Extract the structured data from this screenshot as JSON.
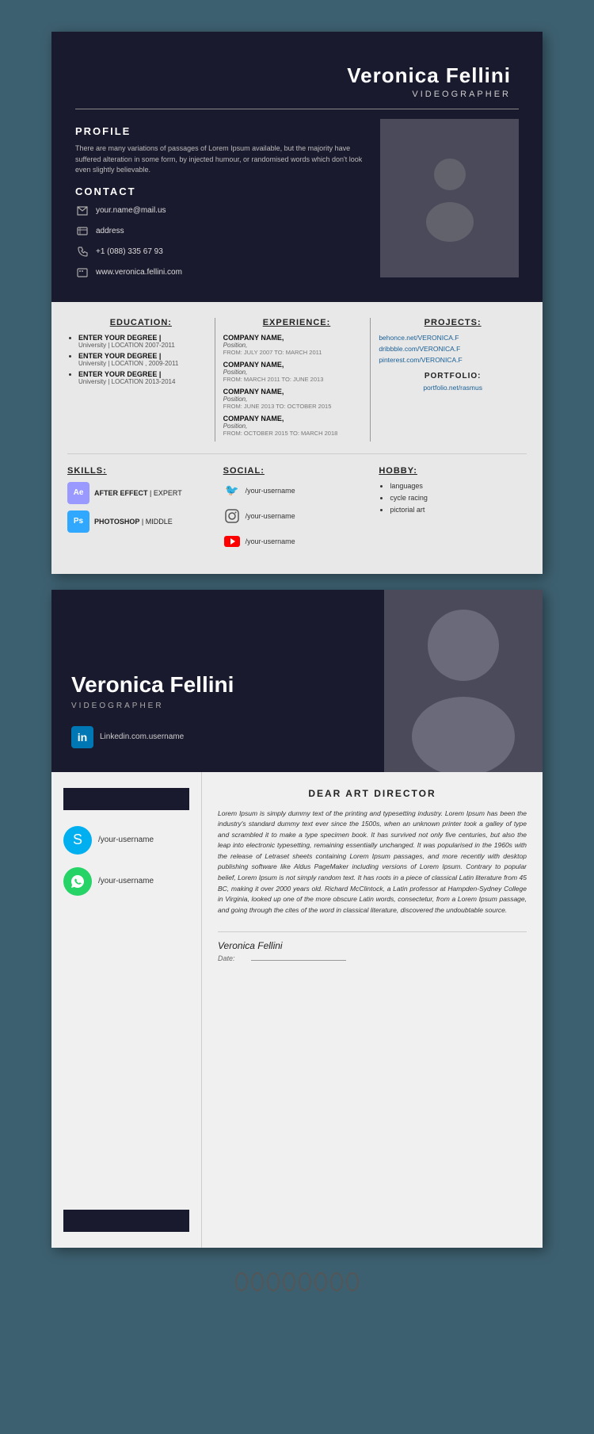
{
  "page": {
    "background_color": "#3d6070"
  },
  "resume1": {
    "header": {
      "name": "Veronica Fellini",
      "title": "VIDEOGRAPHER",
      "profile_label": "PROFILE",
      "profile_text": "There are many variations of passages of Lorem Ipsum available, but the majority have suffered alteration in some form, by injected humour, or randomised words which don't look even slightly believable.",
      "contact_label": "CONTACT",
      "email": "your.name@mail.us",
      "address": "address",
      "phone": "+1 (088) 335 67 93",
      "website": "www.veronica.fellini.com"
    },
    "education": {
      "title": "EDUCATION:",
      "items": [
        {
          "degree": "ENTER YOUR DEGREE |",
          "sub": "University | LOCATION 2007-2011"
        },
        {
          "degree": "ENTER YOUR DEGREE |",
          "sub": "University | LOCATION , 2009-2011"
        },
        {
          "degree": "ENTER YOUR DEGREE |",
          "sub": "University | LOCATION 2013-2014"
        }
      ]
    },
    "experience": {
      "title": "EXPERIENCE:",
      "items": [
        {
          "company": "COMPANY NAME,",
          "position": "Position,",
          "dates": "FROM: JULY 2007 TO: MARCH 2011"
        },
        {
          "company": "COMPANY NAME,",
          "position": "Position,",
          "dates": "FROM: MARCH 2011 TO: JUNE 2013"
        },
        {
          "company": "COMPANY NAME,",
          "position": "Position,",
          "dates": "FROM: JUNE 2013 TO: OCTOBER 2015"
        },
        {
          "company": "COMPANY NAME,",
          "position": "Position,",
          "dates": "FROM: OCTOBER 2015 TO: MARCH 2018"
        }
      ]
    },
    "projects": {
      "title": "PROJECTS:",
      "links": [
        "behonce.net/VERONICA.F",
        "dribbble.com/VERONICA.F",
        "pinterest.com/VERONICA.F"
      ],
      "portfolio_label": "PORTFOLIO:",
      "portfolio_link": "portfolio.net/rasmus"
    },
    "skills": {
      "title": "SKILLS:",
      "items": [
        {
          "name": "AFTER EFFECT",
          "level": "EXPERT",
          "badge": "Ae"
        },
        {
          "name": "PHOTOSHOP",
          "level": "MIDDLE",
          "badge": "Ps"
        }
      ]
    },
    "social": {
      "title": "SOCIAL:",
      "items": [
        {
          "platform": "twitter",
          "handle": "/your-username"
        },
        {
          "platform": "instagram",
          "handle": "/your-username"
        },
        {
          "platform": "youtube",
          "handle": "/your-username"
        }
      ]
    },
    "hobby": {
      "title": "HOBBY:",
      "items": [
        "languages",
        "cycle racing",
        "pictorial art"
      ]
    }
  },
  "resume2": {
    "header": {
      "name": "Veronica Fellini",
      "title": "VIDEOGRAPHER",
      "linkedin": "Linkedin.com.username"
    },
    "cover_body": {
      "dear_title": "DEAR ART DIRECTOR",
      "letter_text": "Lorem Ipsum is simply dummy text of the printing and typesetting industry. Lorem Ipsum has been the industry's standard dummy text ever since the 1500s, when an unknown printer took a galley of type and scrambled it to make a type specimen book. It has survived not only five centuries, but also the leap into electronic typesetting, remaining essentially unchanged. It was popularised in the 1960s with the release of Letraset sheets containing Lorem Ipsum passages, and more recently with desktop publishing software like Aldus PageMaker including versions of Lorem Ipsum. Contrary to popular belief, Lorem Ipsum is not simply random text. It has roots in a piece of classical Latin literature from 45 BC, making it over 2000 years old. Richard McClintock, a Latin professor at Hampden-Sydney College in Virginia, looked up one of the more obscure Latin words, consectetur, from a Lorem Ipsum passage, and going through the cites of the word in classical literature, discovered the undoubtable source.",
      "skype_handle": "/your-username",
      "whatsapp_handle": "/your-username",
      "signature_name": "Veronica Fellini",
      "signature_date_label": "Date:"
    }
  }
}
